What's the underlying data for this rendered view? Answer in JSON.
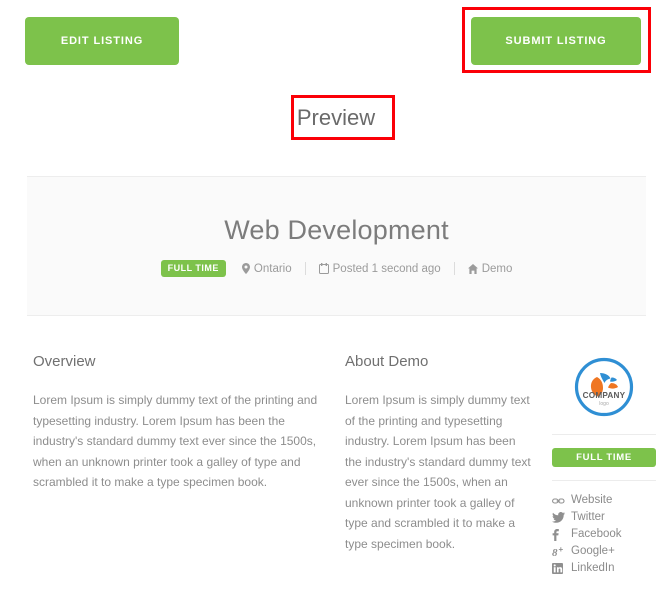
{
  "toolbar": {
    "edit_listing_label": "EDIT LISTING",
    "submit_listing_label": "SUBMIT LISTING",
    "highlight_color": "#fb0007",
    "button_color": "#7dc24b"
  },
  "preview": {
    "heading": "Preview"
  },
  "job_header": {
    "title": "Web Development",
    "badge": "FULL TIME",
    "location": "Ontario",
    "posted": "Posted 1 second ago",
    "company": "Demo"
  },
  "overview": {
    "title": "Overview",
    "body": "Lorem Ipsum is simply dummy text of the printing and typesetting industry. Lorem Ipsum has been the industry's standard dummy text ever since the 1500s, when an unknown printer took a galley of type and scrambled it to make a type specimen book."
  },
  "about": {
    "title": "About Demo",
    "body": "Lorem Ipsum is simply dummy text of the printing and typesetting industry. Lorem Ipsum has been the industry's standard dummy text ever since the 1500s, when an unknown printer took a galley of type and scrambled it to make a type specimen book."
  },
  "sidebar": {
    "logo_text": "COMPANY",
    "logo_subtext": "logo",
    "job_type_badge": "FULL TIME",
    "social_links": [
      {
        "icon": "link-icon",
        "label": "Website"
      },
      {
        "icon": "twitter-icon",
        "label": "Twitter"
      },
      {
        "icon": "facebook-icon",
        "label": "Facebook"
      },
      {
        "icon": "googleplus-icon",
        "label": "Google+"
      },
      {
        "icon": "linkedin-icon",
        "label": "LinkedIn"
      }
    ]
  }
}
